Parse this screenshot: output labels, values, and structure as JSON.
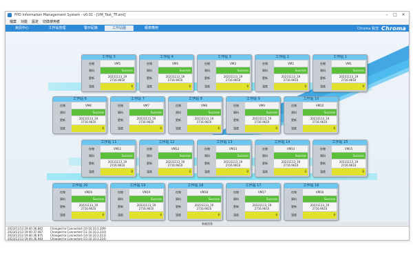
{
  "window": {
    "title": "FPD Information Management System - v0.01 - [VM_Test_TF.xml]",
    "controls": [
      "–",
      "□",
      "✕"
    ]
  },
  "menu": [
    "檔案",
    "功能",
    "設定",
    "切換使用者"
  ],
  "nav": {
    "tabs": [
      {
        "label": "資訊中心",
        "active": false
      },
      {
        "label": "工作站管理",
        "active": false
      },
      {
        "label": "警示紀錄",
        "active": false
      },
      {
        "label": "工作站圖",
        "active": true
      },
      {
        "label": "報表應用",
        "active": false
      }
    ],
    "brand_name": "Chroma 致茂",
    "brand_logo": "Chroma"
  },
  "row_labels": {
    "status": "在線",
    "result": "資料",
    "time": "更新",
    "temp": "溫度"
  },
  "stations": [
    {
      "name": "工作站 5",
      "vm": "VM5",
      "result": "Success",
      "time": "20231113_19 2716.9610",
      "temp": "0"
    },
    {
      "name": "工作站 4",
      "vm": "VM4",
      "result": "Success",
      "time": "20231113_19 2716.9610",
      "temp": "0"
    },
    {
      "name": "工作站 3",
      "vm": "VM3",
      "result": "Success",
      "time": "20231113_19 2716.9610",
      "temp": "0"
    },
    {
      "name": "工作站 2",
      "vm": "VM2",
      "result": "Success",
      "time": "20231113_19 2716.9610",
      "temp": "0"
    },
    {
      "name": "工作站 1",
      "vm": "VM1",
      "result": "Success",
      "time": "20231113_19 2716.9610",
      "temp": "0"
    },
    {
      "name": "工作站 6",
      "vm": "VM6",
      "result": "Success",
      "time": "20231113_19 2716.9610",
      "temp": "0"
    },
    {
      "name": "工作站 7",
      "vm": "VM7",
      "result": "Success",
      "time": "20231113_19 2716.9610",
      "temp": "0"
    },
    {
      "name": "工作站 8",
      "vm": "VM8",
      "result": "Success",
      "time": "20231113_19 2716.9610",
      "temp": "0"
    },
    {
      "name": "工作站 9",
      "vm": "VM9",
      "result": "Success",
      "time": "20231113_19 2716.9610",
      "temp": "0"
    },
    {
      "name": "工作站 10",
      "vm": "VM10",
      "result": "Success",
      "time": "20231113_19 2716.9610",
      "temp": "0"
    },
    {
      "name": "工作站 11",
      "vm": "VM11",
      "result": "Success",
      "time": "20231113_19 2716.9610",
      "temp": "0"
    },
    {
      "name": "工作站 12",
      "vm": "VM12",
      "result": "Success",
      "time": "20231113_19 2716.9610",
      "temp": "0"
    },
    {
      "name": "工作站 13",
      "vm": "VM13",
      "result": "Success",
      "time": "20231113_19 2716.9610",
      "temp": "0"
    },
    {
      "name": "工作站 14",
      "vm": "VM14",
      "result": "Success",
      "time": "20231113_19 2716.9610",
      "temp": "0"
    },
    {
      "name": "工作站 15",
      "vm": "VM15",
      "result": "Success",
      "time": "20231113_19 2716.9610",
      "temp": "0"
    },
    {
      "name": "工作站 20",
      "vm": "VM20",
      "result": "Success",
      "time": "20231113_19 2716.9610",
      "temp": "0"
    },
    {
      "name": "工作站 19",
      "vm": "VM19",
      "result": "Success",
      "time": "20231113_19 2716.9610",
      "temp": "0"
    },
    {
      "name": "工作站 18",
      "vm": "VM18",
      "result": "Success",
      "time": "20231113_19 2716.9610",
      "temp": "0"
    },
    {
      "name": "工作站 17",
      "vm": "VM17",
      "result": "Success",
      "time": "20231113_19 2716.9610",
      "temp": "0"
    },
    {
      "name": "工作站 16",
      "vm": "VM16",
      "result": "Success",
      "time": "20231113_19 2716.9610",
      "temp": "0"
    }
  ],
  "log": {
    "header": "系統訊息",
    "rows": [
      {
        "time": "2023/11/13 19:40:36.842",
        "msg": "Changed to Connected (10-10.10.3.209)"
      },
      {
        "time": "2023/11/13 19:40:37.087",
        "msg": "Changed to Connected (11-10.10.3.210)"
      },
      {
        "time": "2023/11/13 19:40:36.875",
        "msg": "Changed to Connected (14-10.10.3.213)"
      },
      {
        "time": "2023/11/13 19:40:36.940",
        "msg": "Changed to Connected (15-10.10.3.214)"
      }
    ]
  },
  "colors": {
    "nav_bar": "#2e8ad8",
    "station_header": "#6cc6f0",
    "success": "#5cbf3a",
    "temp_cell": "#e0e32a",
    "flow_band": "#5fe0f2"
  }
}
